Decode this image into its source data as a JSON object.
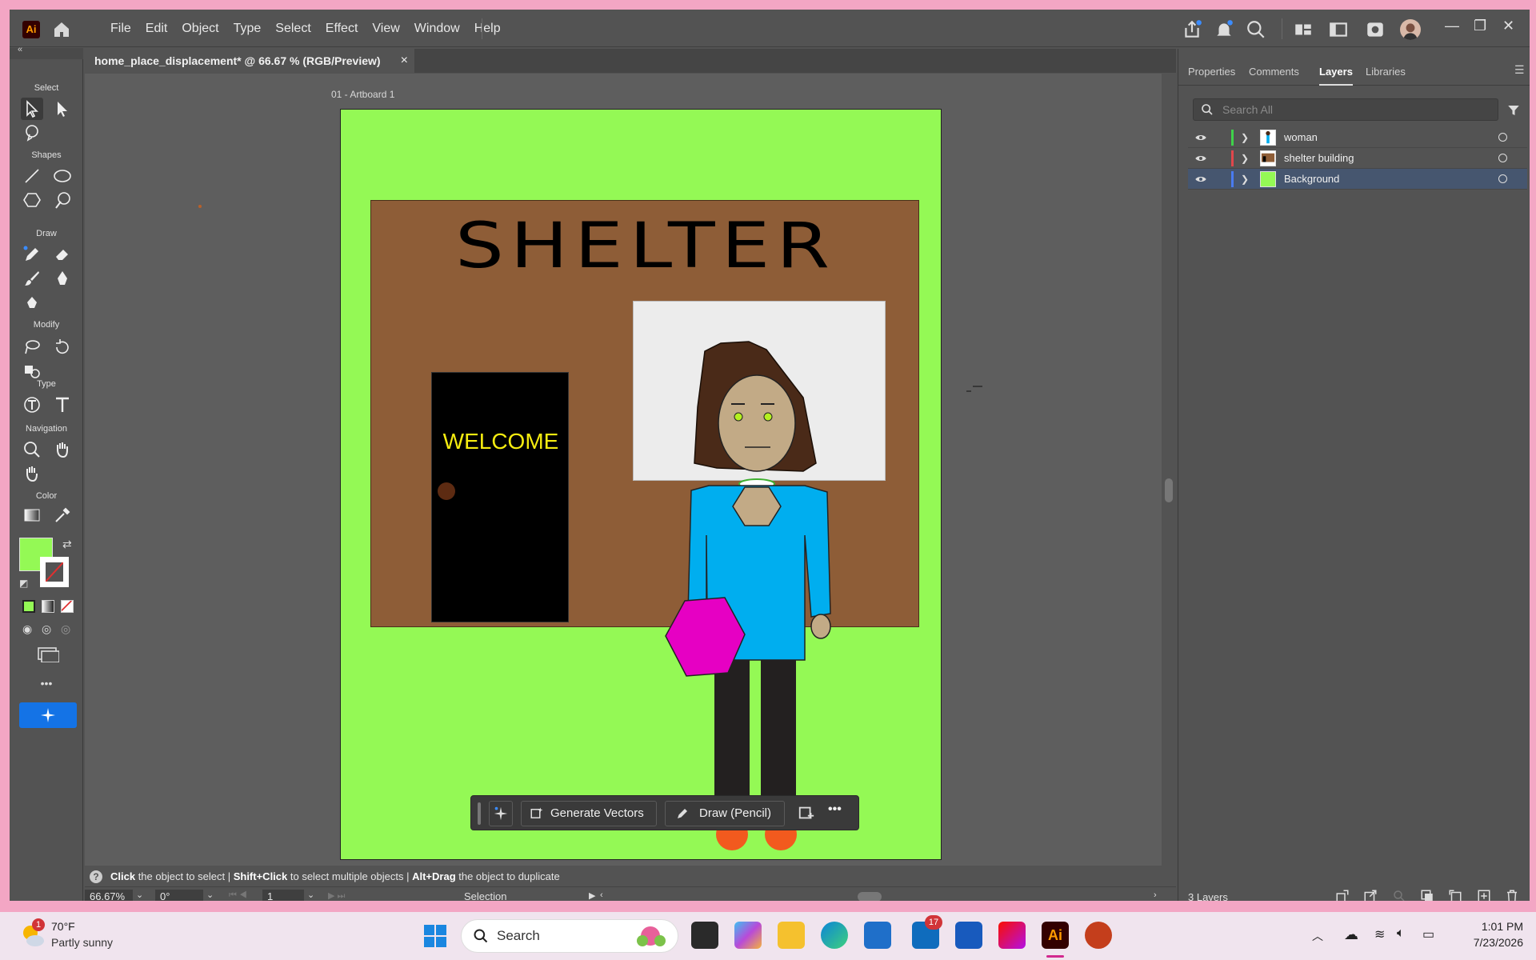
{
  "app": {
    "logo": "Ai"
  },
  "menus": [
    "File",
    "Edit",
    "Object",
    "Type",
    "Select",
    "Effect",
    "View",
    "Window",
    "Help"
  ],
  "toolbar": {
    "sections": [
      "Select",
      "Shapes",
      "Draw",
      "Modify",
      "Type",
      "Navigation",
      "Color"
    ],
    "more": "•••"
  },
  "document": {
    "tab_title": "home_place_displacement* @ 66.67 % (RGB/Preview)",
    "close": "×",
    "artboard_label": "01 - Artboard 1"
  },
  "artwork": {
    "sign_text": "SHELTER",
    "door_text": "WELCOME",
    "colors": {
      "background": "#94f955",
      "building": "#8e5d37",
      "sign": "#000000",
      "door_text": "#f5ec10",
      "shirt": "#00aeef",
      "bag": "#e600c3",
      "hair": "#4a2a18",
      "skin": "#c2aa86"
    }
  },
  "contextbar": {
    "generate": "Generate Vectors",
    "draw": "Draw (Pencil)",
    "more": "•••"
  },
  "status": {
    "hint_parts": [
      {
        "bold": "Click",
        "text": " the object to select  |  "
      },
      {
        "bold": "Shift+Click",
        "text": " to select multiple objects  |  "
      },
      {
        "bold": "Alt+Drag",
        "text": " the object to duplicate"
      }
    ],
    "zoom": "66.67%",
    "rotation": "0°",
    "artboard": "1",
    "mode": "Selection"
  },
  "panel": {
    "tabs": [
      "Properties",
      "Comments",
      "Layers",
      "Libraries"
    ],
    "active_tab": "Layers",
    "search_placeholder": "Search All",
    "layers": [
      {
        "name": "woman",
        "color": "#3fd24b",
        "selected": false
      },
      {
        "name": "shelter building",
        "color": "#e0474c",
        "selected": false
      },
      {
        "name": "Background",
        "color": "#4a7bf0",
        "selected": true
      }
    ],
    "footer": "3 Layers"
  },
  "taskbar": {
    "weather_temp": "70°F",
    "weather_text": "Partly sunny",
    "weather_badge": "1",
    "search": "Search",
    "notif_badge": "17",
    "time": "1:01 PM",
    "date": "7/23/2026"
  }
}
